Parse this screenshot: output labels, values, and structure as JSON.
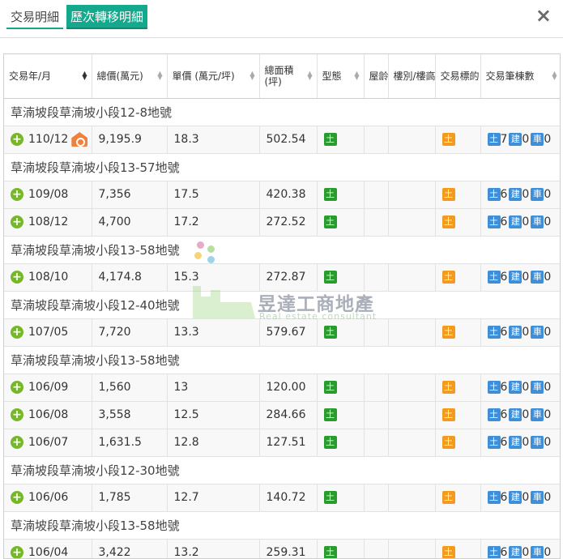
{
  "tabs": [
    {
      "label": "交易明細",
      "active": false
    },
    {
      "label": "歷次轉移明細",
      "active": true
    }
  ],
  "close_icon": "×",
  "columns": [
    {
      "label": "交易年/月",
      "sort": "active"
    },
    {
      "label": "總價(萬元)",
      "sort": "none"
    },
    {
      "label": "單價 (萬元/坪)",
      "sort": "none"
    },
    {
      "label": "總面積\n(坪)",
      "sort": "none"
    },
    {
      "label": "型態",
      "sort": "none"
    },
    {
      "label": "屋齡",
      "sort": "none"
    },
    {
      "label": "樓別/樓高",
      "sort": "none"
    },
    {
      "label": "交易標的",
      "sort": "none"
    },
    {
      "label": "交易筆棟數",
      "sort": "none"
    }
  ],
  "badge_labels": {
    "land": "土",
    "building": "建",
    "car": "車"
  },
  "groups": [
    {
      "title": "草湳坡段草湳坡小段12-8地號",
      "rows": [
        {
          "date": "110/12",
          "has_house_icon": true,
          "total": "9,195.9",
          "unit": "18.3",
          "area": "502.54",
          "land": "7",
          "building": "0",
          "car": "0"
        }
      ]
    },
    {
      "title": "草湳坡段草湳坡小段13-57地號",
      "rows": [
        {
          "date": "109/08",
          "has_house_icon": false,
          "total": "7,356",
          "unit": "17.5",
          "area": "420.38",
          "land": "6",
          "building": "0",
          "car": "0"
        },
        {
          "date": "108/12",
          "has_house_icon": false,
          "total": "4,700",
          "unit": "17.2",
          "area": "272.52",
          "land": "6",
          "building": "0",
          "car": "0"
        }
      ]
    },
    {
      "title": "草湳坡段草湳坡小段13-58地號",
      "rows": [
        {
          "date": "108/10",
          "has_house_icon": false,
          "total": "4,174.8",
          "unit": "15.3",
          "area": "272.87",
          "land": "6",
          "building": "0",
          "car": "0"
        }
      ]
    },
    {
      "title": "草湳坡段草湳坡小段12-40地號",
      "rows": [
        {
          "date": "107/05",
          "has_house_icon": false,
          "total": "7,720",
          "unit": "13.3",
          "area": "579.67",
          "land": "6",
          "building": "0",
          "car": "0"
        }
      ]
    },
    {
      "title": "草湳坡段草湳坡小段13-58地號",
      "rows": [
        {
          "date": "106/09",
          "has_house_icon": false,
          "total": "1,560",
          "unit": "13",
          "area": "120.00",
          "land": "6",
          "building": "0",
          "car": "0"
        },
        {
          "date": "106/08",
          "has_house_icon": false,
          "total": "3,558",
          "unit": "12.5",
          "area": "284.66",
          "land": "6",
          "building": "0",
          "car": "0"
        },
        {
          "date": "106/07",
          "has_house_icon": false,
          "total": "1,631.5",
          "unit": "12.8",
          "area": "127.51",
          "land": "6",
          "building": "0",
          "car": "0"
        }
      ]
    },
    {
      "title": "草湳坡段草湳坡小段12-30地號",
      "rows": [
        {
          "date": "106/06",
          "has_house_icon": false,
          "total": "1,785",
          "unit": "12.7",
          "area": "140.72",
          "land": "6",
          "building": "0",
          "car": "0"
        }
      ]
    },
    {
      "title": "草湳坡段草湳坡小段13-58地號",
      "rows": [
        {
          "date": "106/04",
          "has_house_icon": false,
          "total": "3,422",
          "unit": "13.2",
          "area": "259.31",
          "land": "6",
          "building": "0",
          "car": "0"
        }
      ]
    }
  ],
  "watermark": {
    "title": "昱達工商地產",
    "subtitle": "Real estate consultant"
  },
  "colors": {
    "tab_active": "#14a98c",
    "plus": "#76b82a",
    "type_badge": "#2a9c2f",
    "target_badge": "#f29b1e",
    "count_badge": "#3e8ed8",
    "house_icon": "#f0813a"
  }
}
